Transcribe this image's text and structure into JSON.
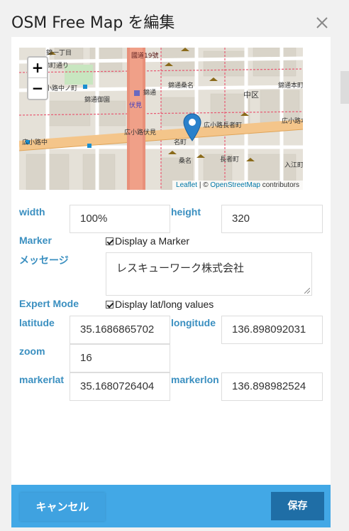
{
  "dialog": {
    "title": "OSM Free Map を編集",
    "close_label": "×"
  },
  "map": {
    "zoom_in": "+",
    "zoom_out": "−",
    "attribution_leaflet": "Leaflet",
    "attribution_sep": " | © ",
    "attribution_osm": "OpenStreetMap",
    "attribution_tail": " contributors",
    "labels": [
      "錦一丁目",
      "錦町通り",
      "錦通桑名",
      "錦通本町",
      "中区",
      "錦通御園",
      "錦通",
      "広小路中ノ町",
      "伏見",
      "広小路伏見",
      "広小路長者町",
      "広小路本町",
      "広小路中",
      "入江町",
      "名町",
      "長者町",
      "桑名",
      "國道19號"
    ]
  },
  "form": {
    "width_label": "width",
    "width_value": "100%",
    "height_label": "height",
    "height_value": "320",
    "marker_label": "Marker",
    "marker_check": "Display a Marker",
    "message_label": "メッセージ",
    "message_value": "レスキューワーク株式会社",
    "expert_label": "Expert Mode",
    "expert_check": "Display lat/long values",
    "latitude_label": "latitude",
    "latitude_value": "35.1686865702",
    "longitude_label": "longitude",
    "longitude_value": "136.898092031",
    "zoom_label": "zoom",
    "zoom_value": "16",
    "markerlat_label": "markerlat",
    "markerlat_value": "35.1680726404",
    "markerlon_label": "markerlon",
    "markerlon_value": "136.898982524"
  },
  "footer": {
    "cancel_label": "キャンセル",
    "save_label": "保存"
  },
  "colors": {
    "accent": "#42a8e6",
    "save": "#1f6ea6",
    "label": "#3a8fc0"
  }
}
